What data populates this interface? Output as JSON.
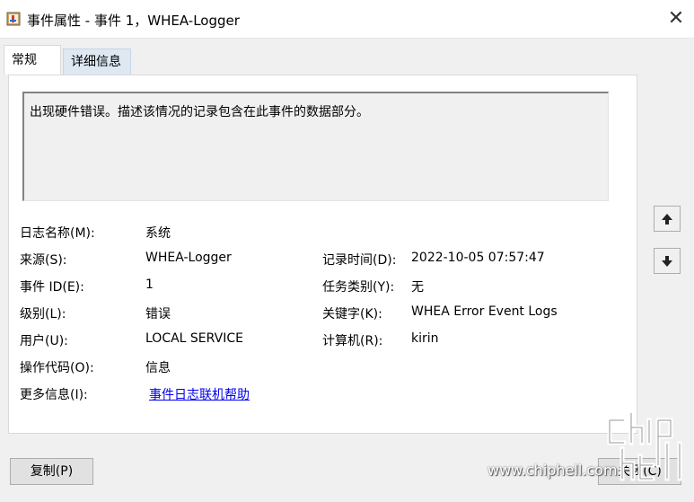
{
  "window": {
    "title": "事件属性 - 事件 1，WHEA-Logger",
    "close_glyph": "✕"
  },
  "tabs": [
    {
      "label": "常规",
      "active": true
    },
    {
      "label": "详细信息",
      "active": false
    }
  ],
  "description": "出现硬件错误。描述该情况的记录包含在此事件的数据部分。",
  "fields": {
    "log_name": {
      "label": "日志名称(M):",
      "value": "系统"
    },
    "source": {
      "label": "来源(S):",
      "value": "WHEA-Logger"
    },
    "event_id": {
      "label": "事件 ID(E):",
      "value": "1"
    },
    "level": {
      "label": "级别(L):",
      "value": "错误"
    },
    "user": {
      "label": "用户(U):",
      "value": "LOCAL SERVICE"
    },
    "opcode": {
      "label": "操作代码(O):",
      "value": "信息"
    },
    "more_info": {
      "label": "更多信息(I):",
      "value": "事件日志联机帮助"
    },
    "logged": {
      "label": "记录时间(D):",
      "value": "2022-10-05 07:57:47"
    },
    "task_category": {
      "label": "任务类别(Y):",
      "value": "无"
    },
    "keywords": {
      "label": "关键字(K):",
      "value": "WHEA Error Event Logs"
    },
    "computer": {
      "label": "计算机(R):",
      "value": "kirin"
    }
  },
  "side_buttons": {
    "up_icon": "arrow-up-icon",
    "down_icon": "arrow-down-icon"
  },
  "buttons": {
    "copy": "复制(P)",
    "close": "关闭(C)"
  },
  "watermark": {
    "text": "www.chiphell.com"
  },
  "colors": {
    "link": "#0000ee",
    "inactive_tab": "#dde8f3",
    "panel": "#ffffff"
  }
}
